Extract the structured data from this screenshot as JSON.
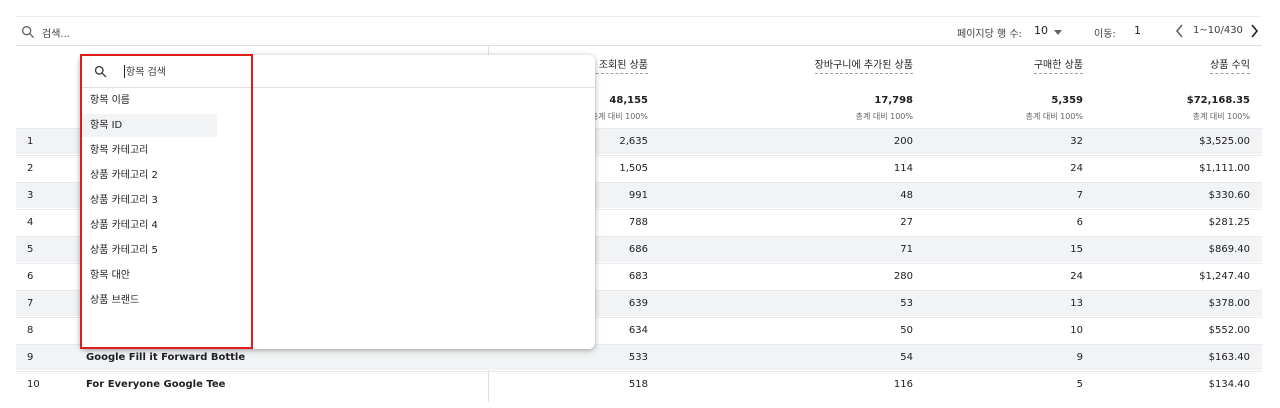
{
  "toolbar": {
    "search_placeholder": "검색...",
    "rows_per_page_label": "페이지당 행 수:",
    "rows_per_page_value": "10",
    "goto_label": "이동:",
    "goto_value": "1",
    "range_text": "1~10/430",
    "icons": {
      "search": "search-icon",
      "rows_dropdown": "caret-down-icon",
      "prev": "chevron-left-icon",
      "next": "chevron-right-icon"
    }
  },
  "table": {
    "columns": [
      "… 조회된 상품",
      "장바구니에 추가된 상품",
      "구매한 상품",
      "상품 수익"
    ],
    "totals": [
      "48,155",
      "17,798",
      "5,359",
      "$72,168.35"
    ],
    "total_sub": [
      "총계 대비 100%",
      "총계 대비 100%",
      "총계 대비 100%",
      "총계 대비 100%"
    ],
    "rows": [
      {
        "idx": "1",
        "name": "",
        "viewed": "2,635",
        "cart": "200",
        "purchased": "32",
        "revenue": "$3,525.00"
      },
      {
        "idx": "2",
        "name": "",
        "viewed": "1,505",
        "cart": "114",
        "purchased": "24",
        "revenue": "$1,111.00"
      },
      {
        "idx": "3",
        "name": "",
        "viewed": "991",
        "cart": "48",
        "purchased": "7",
        "revenue": "$330.60"
      },
      {
        "idx": "4",
        "name": "",
        "viewed": "788",
        "cart": "27",
        "purchased": "6",
        "revenue": "$281.25"
      },
      {
        "idx": "5",
        "name": "",
        "viewed": "686",
        "cart": "71",
        "purchased": "15",
        "revenue": "$869.40"
      },
      {
        "idx": "6",
        "name": "",
        "viewed": "683",
        "cart": "280",
        "purchased": "24",
        "revenue": "$1,247.40"
      },
      {
        "idx": "7",
        "name": "",
        "viewed": "639",
        "cart": "53",
        "purchased": "13",
        "revenue": "$378.00"
      },
      {
        "idx": "8",
        "name": "",
        "viewed": "634",
        "cart": "50",
        "purchased": "10",
        "revenue": "$552.00"
      },
      {
        "idx": "9",
        "name": "Google Fill it Forward Bottle",
        "viewed": "533",
        "cart": "54",
        "purchased": "9",
        "revenue": "$163.40"
      },
      {
        "idx": "10",
        "name": "For Everyone Google Tee",
        "viewed": "518",
        "cart": "116",
        "purchased": "5",
        "revenue": "$134.40"
      }
    ]
  },
  "dropdown": {
    "search_placeholder": "항목 검색",
    "items": [
      "항목 이름",
      "항목 ID",
      "항목 카테고리",
      "상품 카테고리 2",
      "상품 카테고리 3",
      "상품 카테고리 4",
      "상품 카테고리 5",
      "항목 대안",
      "상품 브랜드"
    ],
    "hovered_index": 1,
    "highlight_color": "#e01b1b"
  }
}
